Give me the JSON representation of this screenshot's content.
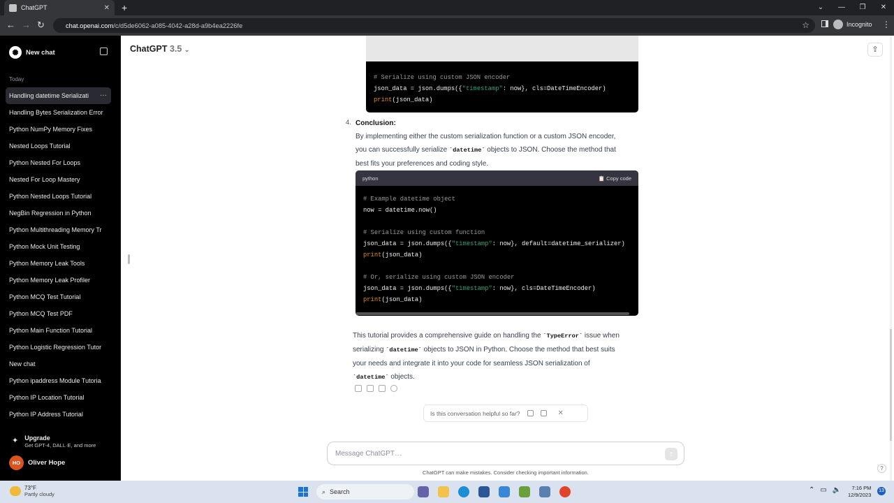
{
  "browser": {
    "tab_title": "ChatGPT",
    "url_domain": "chat.openai.com",
    "url_path": "/c/d5de6062-a085-4042-a28d-a9b4ea2226fe",
    "incognito_label": "Incognito"
  },
  "sidebar": {
    "new_chat": "New chat",
    "section_label": "Today",
    "history": [
      "Handling datetime Serializati",
      "Handling Bytes Serialization Error",
      "Python NumPy Memory Fixes",
      "Nested Loops Tutorial",
      "Python Nested For Loops",
      "Nested For Loop Mastery",
      "Python Nested Loops Tutorial",
      "NegBin Regression in Python",
      "Python Multithreading Memory Tr",
      "Python Mock Unit Testing",
      "Python Memory Leak Tools",
      "Python Memory Leak Profiler",
      "Python MCQ Test Tutorial",
      "Python MCQ Test PDF",
      "Python Main Function Tutorial",
      "Python Logistic Regression Tutor",
      "New chat",
      "Python ipaddress Module Tutoria",
      "Python IP Location Tutorial",
      "Python IP Address Tutorial"
    ],
    "upgrade_title": "Upgrade",
    "upgrade_sub": "Get GPT-4, DALL·E, and more",
    "user_initials": "HO",
    "user_name": "Oliver Hope"
  },
  "header": {
    "model": "ChatGPT",
    "version": "3.5"
  },
  "code1": {
    "comment": "# Serialize using custom JSON encoder",
    "l2a": "json_data = json.dumps({",
    "l2s": "\"timestamp\"",
    "l2b": ": now}, cls=DateTimeEncoder)",
    "l3k": "print",
    "l3b": "(json_data)"
  },
  "conclusion": {
    "number": "4.",
    "title": "Conclusion:",
    "t1": "By implementing either the custom serialization function or a custom JSON encoder,",
    "t2a": "you can successfully serialize ",
    "t2c": "`datetime`",
    "t2b": " objects to JSON. Choose the method that",
    "t3": "best fits your preferences and coding style."
  },
  "code2": {
    "lang": "python",
    "copy": "Copy code",
    "c1": "# Example datetime object",
    "l1": "now = datetime.now()",
    "c2": "# Serialize using custom function",
    "l2a": "json_data = json.dumps({",
    "l2s": "\"timestamp\"",
    "l2b": ": now}, default=datetime_serializer)",
    "l3k": "print",
    "l3b": "(json_data)",
    "c3": "# Or, serialize using custom JSON encoder",
    "l4a": "json_data = json.dumps({",
    "l4s": "\"timestamp\"",
    "l4b": ": now}, cls=DateTimeEncoder)",
    "l5k": "print",
    "l5b": "(json_data)"
  },
  "summary": {
    "l1a": "This tutorial provides a comprehensive guide on handling the ",
    "l1c": "`TypeError`",
    "l1b": " issue when",
    "l2a": "serializing ",
    "l2c": "`datetime`",
    "l2b": " objects to JSON in Python. Choose the method that best suits",
    "l3": "your needs and integrate it into your code for seamless JSON serialization of",
    "l4c": "`datetime`",
    "l4b": " objects."
  },
  "feedback": {
    "question": "Is this conversation helpful so far?"
  },
  "composer": {
    "placeholder": "Message ChatGPT…",
    "disclaimer": "ChatGPT can make mistakes. Consider checking important information."
  },
  "taskbar": {
    "temp": "73°F",
    "weather": "Partly cloudy",
    "search": "Search",
    "time": "7:16 PM",
    "date": "12/9/2023",
    "notifications": "13"
  },
  "colors": {
    "code_string": "#2ea37c",
    "code_keyword": "#e9950c",
    "avatar": "#d9541e"
  }
}
